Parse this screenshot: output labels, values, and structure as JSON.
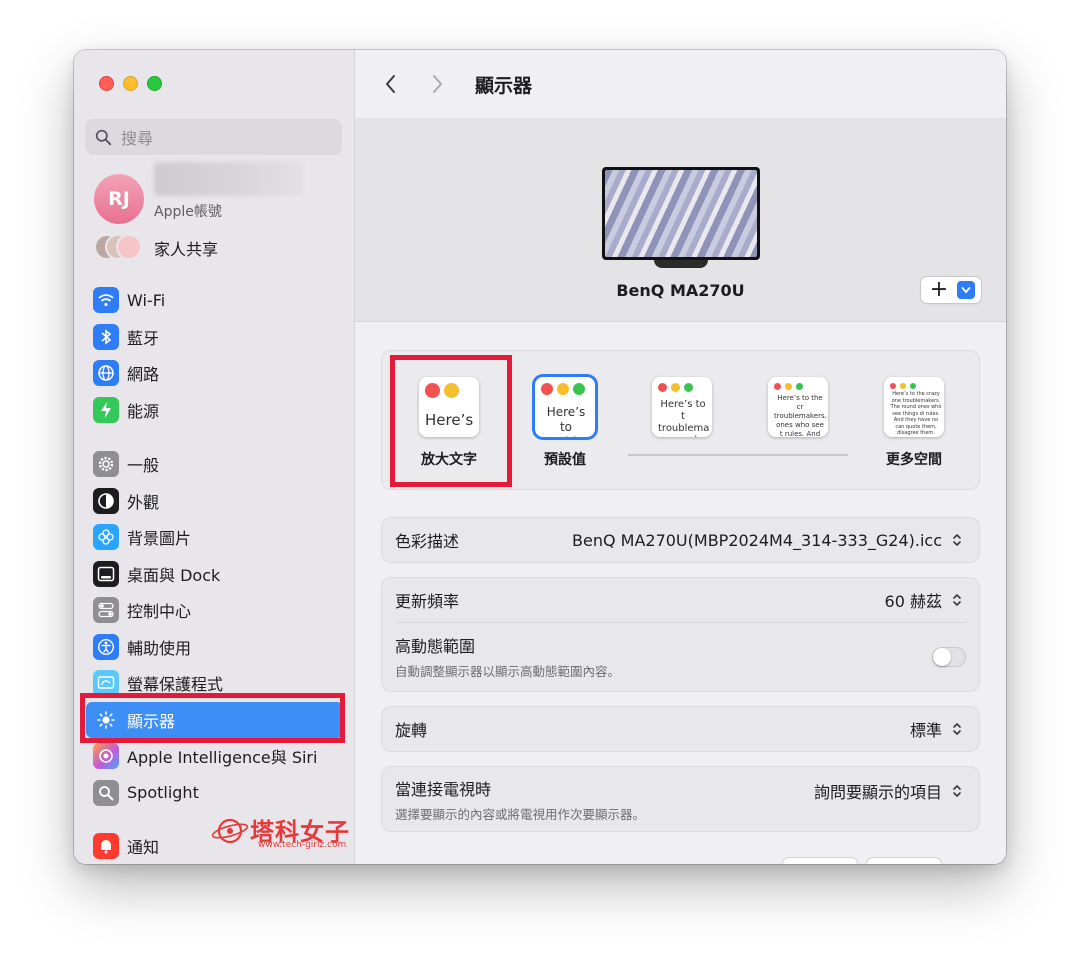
{
  "window": {
    "title": "顯示器"
  },
  "sidebar": {
    "search_placeholder": "搜尋",
    "account": {
      "initials": "RJ",
      "subtitle": "Apple帳號"
    },
    "family_label": "家人共享",
    "groups": [
      [
        {
          "label": "Wi-Fi",
          "icon": "wifi-icon",
          "color": "#2e7cf6"
        },
        {
          "label": "藍牙",
          "icon": "bluetooth-icon",
          "color": "#2e7cf6"
        },
        {
          "label": "網路",
          "icon": "globe-icon",
          "color": "#2e7cf6"
        },
        {
          "label": "能源",
          "icon": "battery-bolt-icon",
          "color": "#34c759"
        }
      ],
      [
        {
          "label": "一般",
          "icon": "gear-icon",
          "color": "#8e8e93"
        },
        {
          "label": "外觀",
          "icon": "appearance-icon",
          "color": "#1d1d1f"
        },
        {
          "label": "背景圖片",
          "icon": "flower-icon",
          "color": "#29a5ff"
        },
        {
          "label": "桌面與 Dock",
          "icon": "dock-icon",
          "color": "#1d1d1f"
        },
        {
          "label": "控制中心",
          "icon": "toggles-icon",
          "color": "#8e8e93"
        },
        {
          "label": "輔助使用",
          "icon": "accessibility-icon",
          "color": "#2e7cf6"
        },
        {
          "label": "螢幕保護程式",
          "icon": "screensaver-icon",
          "color": "#5ac8fa"
        },
        {
          "label": "顯示器",
          "icon": "sun-icon",
          "color": "#3d8ef5",
          "selected": true
        },
        {
          "label": "Apple Intelligence與 Siri",
          "icon": "siri-icon",
          "color": "#c35bd8"
        },
        {
          "label": "Spotlight",
          "icon": "magnifier-icon",
          "color": "#8e8e93"
        }
      ],
      [
        {
          "label": "通知",
          "icon": "bell-icon",
          "color": "#ff3b30"
        }
      ]
    ]
  },
  "display": {
    "monitor_name": "BenQ MA270U",
    "add_button": "+"
  },
  "resolution": {
    "options": [
      {
        "label": "放大文字",
        "sample": "Here’s"
      },
      {
        "label": "預設值",
        "sample": "Here’s to troublem"
      },
      {
        "label": "",
        "sample": "Here’s to t troublema ones who"
      },
      {
        "label": "",
        "sample": "Here’s to the cr troublemakers. ones who see t rules. And they"
      },
      {
        "label": "更多空間",
        "sample": "Here’s to the crazy one troublemakers. The round ones who see things di rules. And they have no can quote them, disagree them. About the only th Because they change th"
      }
    ]
  },
  "settings": {
    "color_profile": {
      "label": "色彩描述",
      "value": "BenQ MA270U(MBP2024M4_314-333_G24).icc"
    },
    "refresh_rate": {
      "label": "更新頻率",
      "value": "60 赫茲"
    },
    "hdr": {
      "label": "高動態範圍",
      "description": "自動調整顯示器以顯示高動態範圍內容。",
      "on": false
    },
    "rotation": {
      "label": "旋轉",
      "value": "標準"
    },
    "tv": {
      "label": "當連接電視時",
      "description": "選擇要顯示的內容或將電視用作次要顯示器。",
      "value": "詢問要顯示的項目"
    }
  },
  "watermark": {
    "text": "塔科女子",
    "url": "www.tech-girlz.com"
  }
}
